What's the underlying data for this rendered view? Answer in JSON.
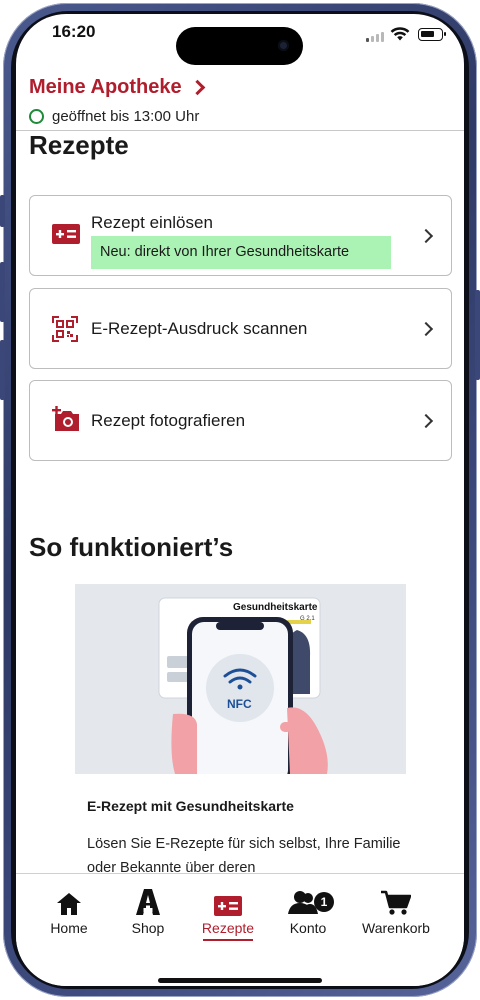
{
  "status_bar": {
    "time": "16:20"
  },
  "pharmacy": {
    "name": "Meine Apotheke",
    "open_status": "geöffnet bis 13:00 Uhr"
  },
  "rezepte": {
    "title": "Rezepte",
    "items": [
      {
        "label": "Rezept einlösen",
        "badge": "Neu: direkt von Ihrer Gesundheitskarte",
        "icon": "card-plus-icon"
      },
      {
        "label": "E-Rezept-Ausdruck scannen",
        "icon": "qr-scan-icon"
      },
      {
        "label": "Rezept fotografieren",
        "icon": "camera-plus-icon"
      }
    ]
  },
  "how_it_works": {
    "title": "So funktioniert’s",
    "illustration": {
      "card_title": "Gesundheitskarte",
      "card_code": "G 2.1",
      "nfc_label": "NFC"
    },
    "card_title": "E-Rezept mit Gesundheitskarte",
    "card_text": "Lösen Sie E-Rezepte für sich selbst, Ihre Familie oder Bekannte über deren"
  },
  "nav": {
    "items": [
      {
        "label": "Home",
        "icon": "home-icon"
      },
      {
        "label": "Shop",
        "icon": "pharmacy-a-icon"
      },
      {
        "label": "Rezepte",
        "icon": "card-plus-icon",
        "active": true
      },
      {
        "label": "Konto",
        "icon": "users-icon",
        "badge": "1"
      },
      {
        "label": "Warenkorb",
        "icon": "cart-icon"
      }
    ]
  },
  "colors": {
    "brand": "#b01e2d",
    "badge_bg": "#abf3b5",
    "open_green": "#1f8a3c"
  }
}
